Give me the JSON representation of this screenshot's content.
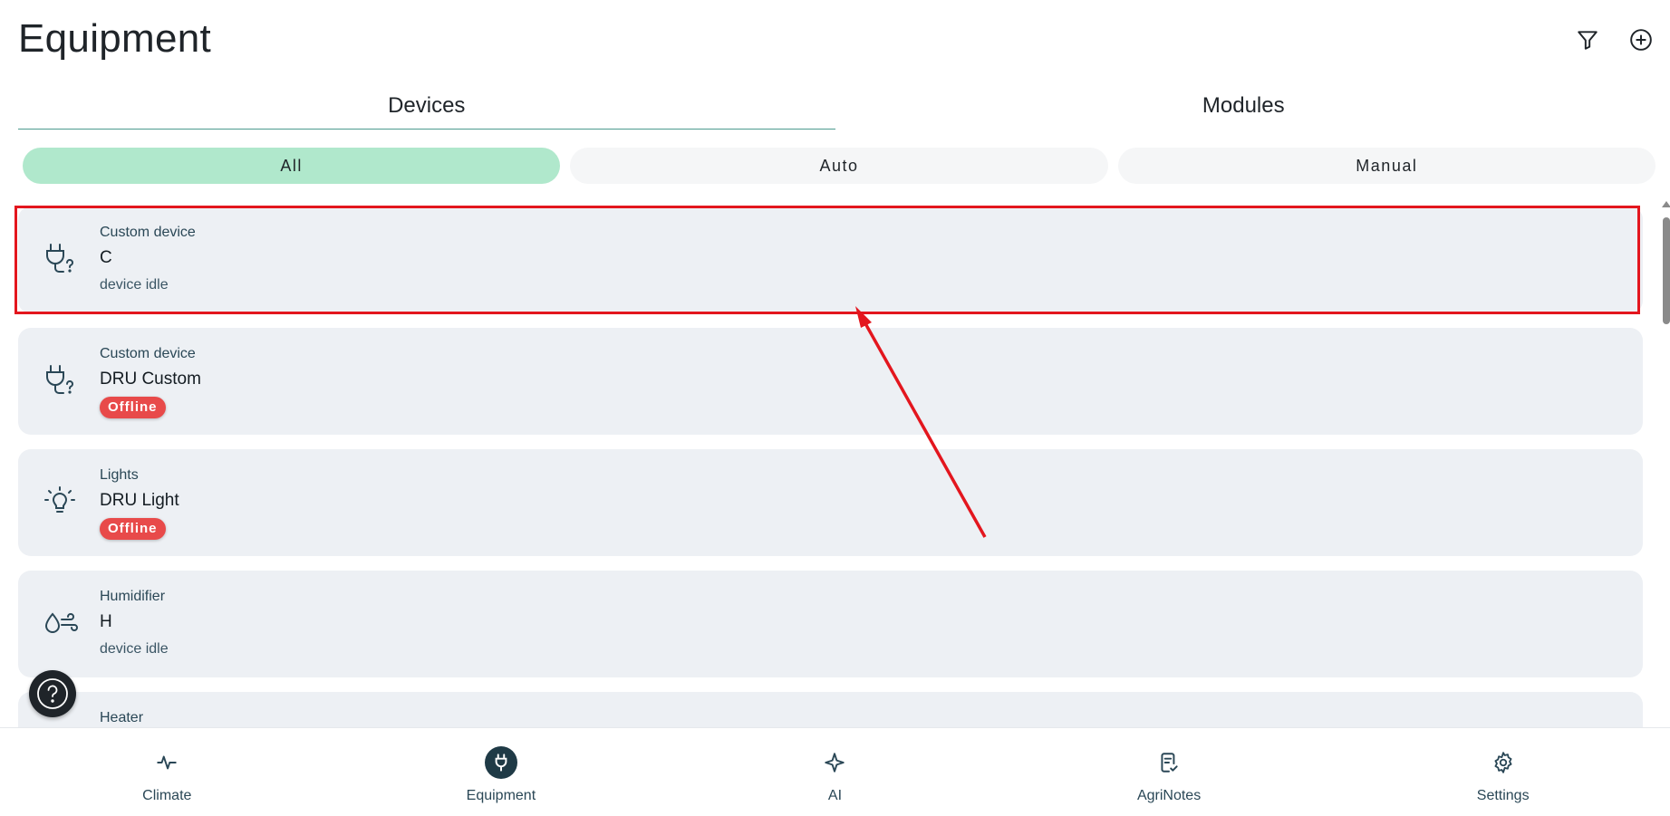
{
  "header": {
    "title": "Equipment",
    "filter_icon": "filter-icon",
    "add_icon": "plus-circle-icon"
  },
  "tabs": [
    {
      "label": "Devices",
      "active": true
    },
    {
      "label": "Modules",
      "active": false
    }
  ],
  "filters": [
    {
      "label": "All",
      "active": true
    },
    {
      "label": "Auto",
      "active": false
    },
    {
      "label": "Manual",
      "active": false
    }
  ],
  "devices": [
    {
      "type": "Custom device",
      "name": "C",
      "status": "device idle",
      "icon": "plug-question-icon"
    },
    {
      "type": "Custom device",
      "name": "DRU Custom",
      "badge": "Offline",
      "icon": "plug-question-icon"
    },
    {
      "type": "Lights",
      "name": "DRU Light",
      "badge": "Offline",
      "icon": "lightbulb-icon"
    },
    {
      "type": "Humidifier",
      "name": "H",
      "status": "device idle",
      "icon": "humidifier-icon"
    },
    {
      "type": "Heater",
      "name": "",
      "status": "",
      "icon": "heater-icon"
    }
  ],
  "nav": [
    {
      "label": "Climate",
      "icon": "activity-icon",
      "active": false
    },
    {
      "label": "Equipment",
      "icon": "plug-icon",
      "active": true
    },
    {
      "label": "AI",
      "icon": "sparkle-icon",
      "active": false
    },
    {
      "label": "AgriNotes",
      "icon": "notes-check-icon",
      "active": false
    },
    {
      "label": "Settings",
      "icon": "gear-icon",
      "active": false
    }
  ],
  "colors": {
    "accent": "#b0e8cc",
    "tab_underline": "#4d9a8e",
    "offline": "#e84a4a",
    "highlight": "#e3161e",
    "card_bg": "#edf0f4"
  }
}
